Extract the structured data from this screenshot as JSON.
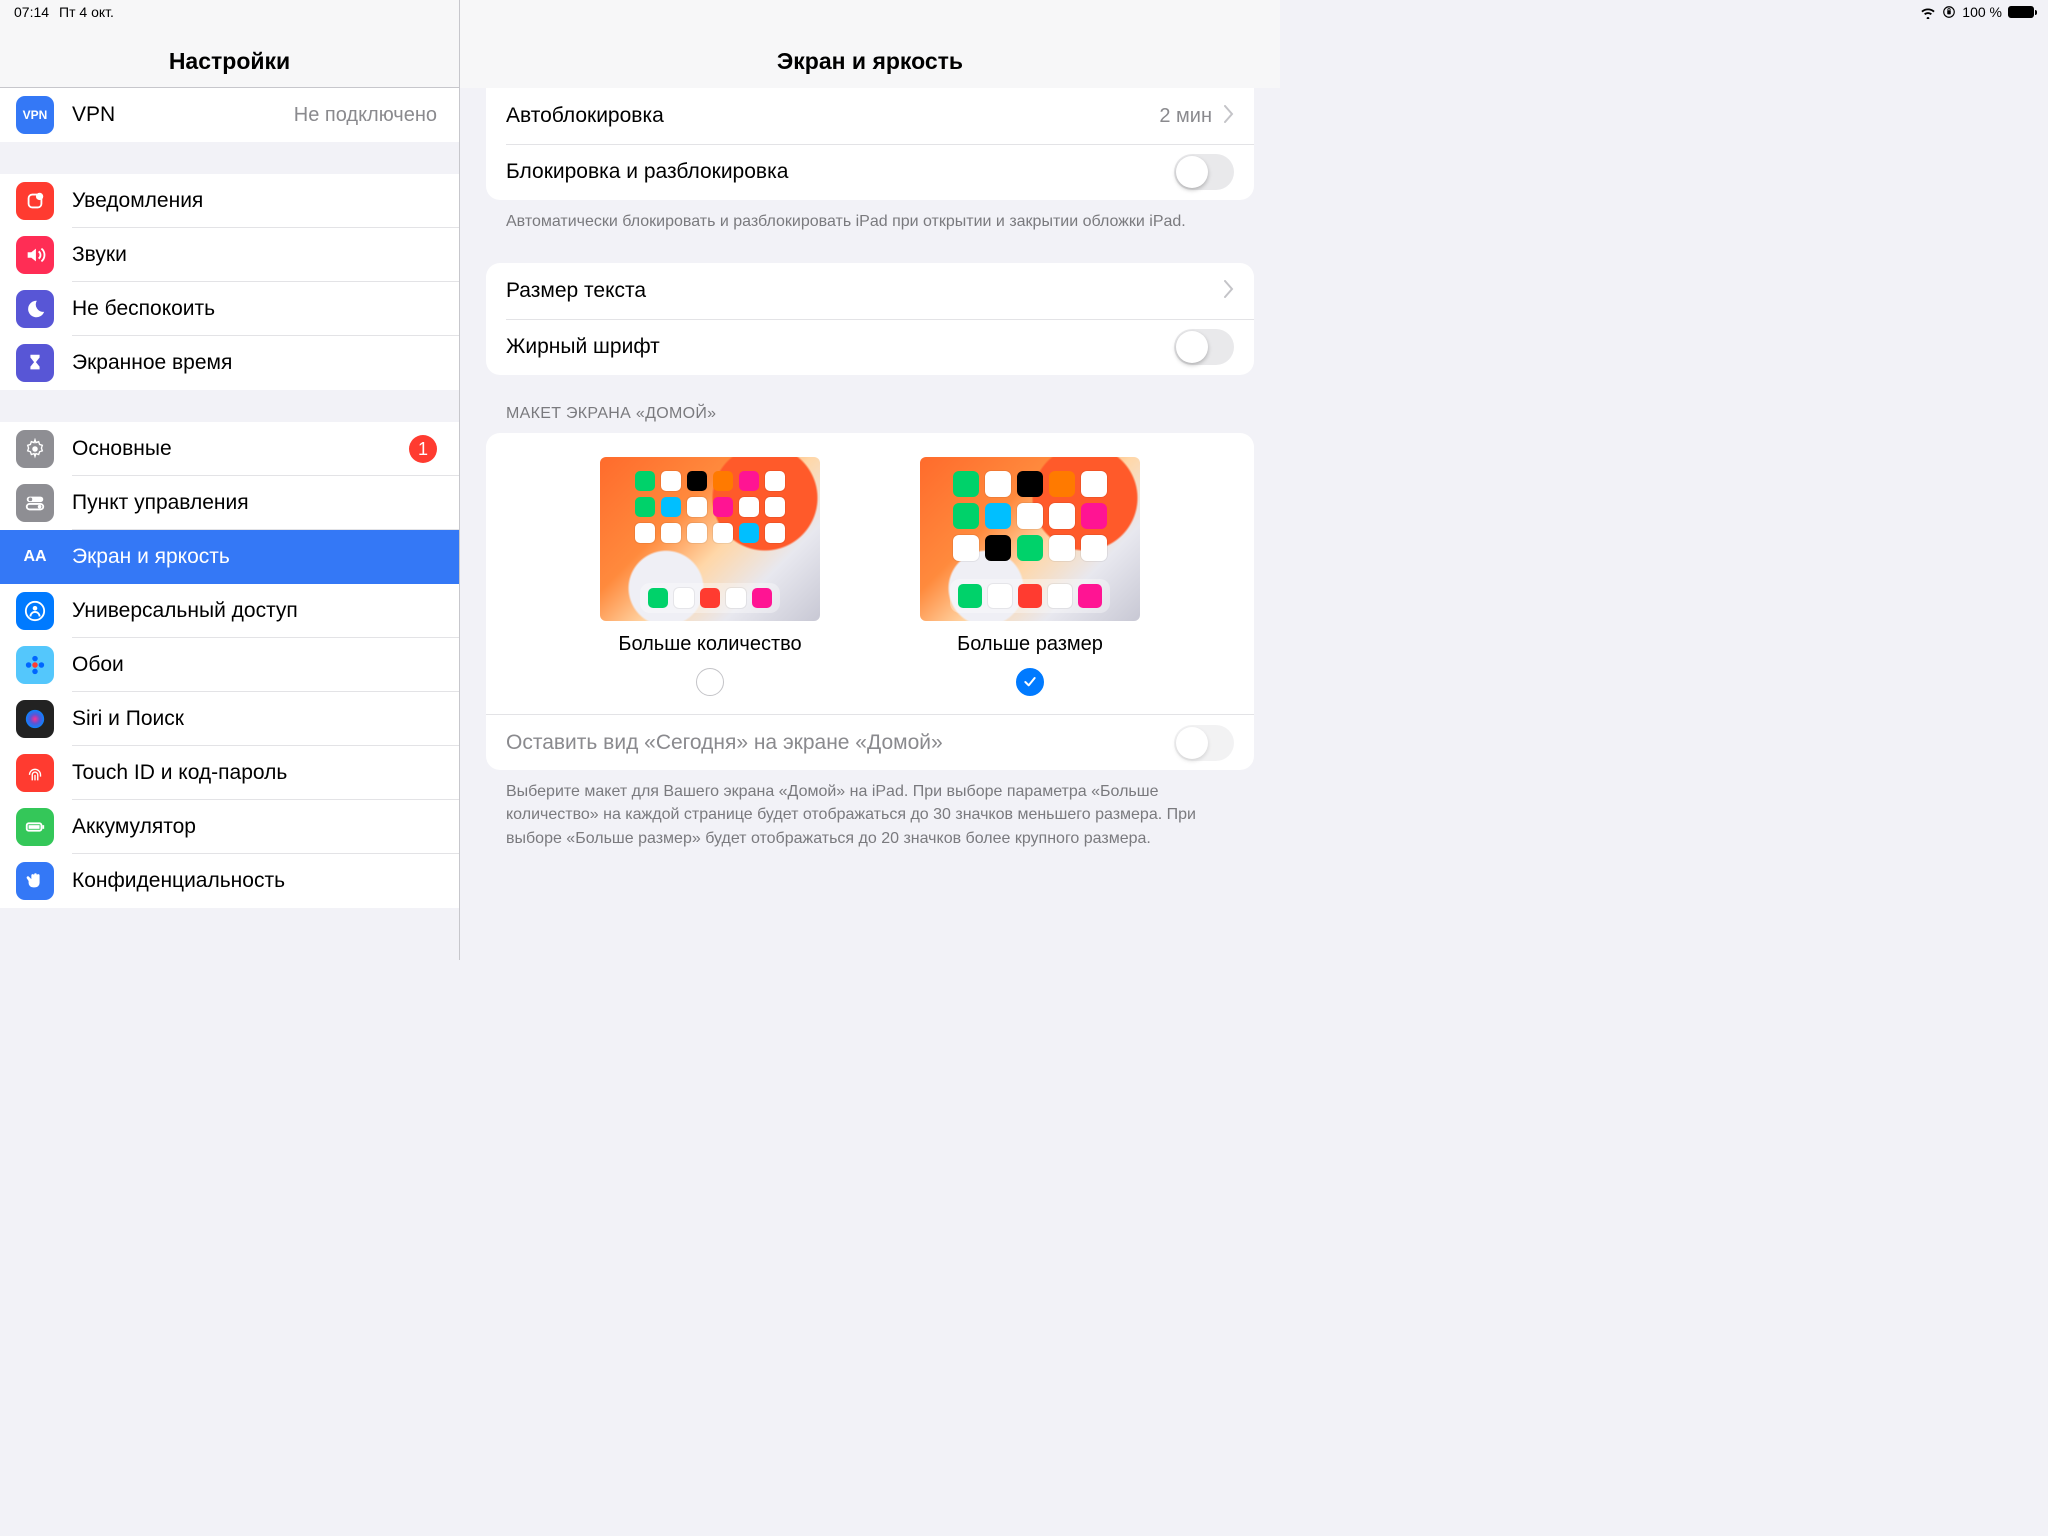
{
  "status": {
    "time": "07:14",
    "date": "Пт 4 окт.",
    "battery": "100 %"
  },
  "sidebar": {
    "title": "Настройки",
    "groups": [
      {
        "items": [
          {
            "id": "vpn",
            "label": "VPN",
            "status": "Не подключено",
            "icon": "vpn",
            "bg": "#3478f6"
          }
        ]
      },
      {
        "items": [
          {
            "id": "notifications",
            "label": "Уведомления",
            "icon": "bell",
            "bg": "#ff3b30"
          },
          {
            "id": "sounds",
            "label": "Звуки",
            "icon": "speaker",
            "bg": "#ff2d55"
          },
          {
            "id": "dnd",
            "label": "Не беспокоить",
            "icon": "moon",
            "bg": "#5856d6"
          },
          {
            "id": "screentime",
            "label": "Экранное время",
            "icon": "hourglass",
            "bg": "#5856d6"
          }
        ]
      },
      {
        "items": [
          {
            "id": "general",
            "label": "Основные",
            "icon": "gear",
            "bg": "#8e8e93",
            "badge": "1"
          },
          {
            "id": "control",
            "label": "Пункт управления",
            "icon": "toggles",
            "bg": "#8e8e93"
          },
          {
            "id": "display",
            "label": "Экран и яркость",
            "icon": "aa",
            "bg": "#3478f6",
            "selected": true
          },
          {
            "id": "accessibility",
            "label": "Универсальный доступ",
            "icon": "person",
            "bg": "#007aff"
          },
          {
            "id": "wallpaper",
            "label": "Обои",
            "icon": "flower",
            "bg": "#54c7fc"
          },
          {
            "id": "siri",
            "label": "Siri и Поиск",
            "icon": "siri",
            "bg": "#222"
          },
          {
            "id": "touchid",
            "label": "Touch ID и код-пароль",
            "icon": "finger",
            "bg": "#ff3b30"
          },
          {
            "id": "battery",
            "label": "Аккумулятор",
            "icon": "battery",
            "bg": "#34c759"
          },
          {
            "id": "privacy",
            "label": "Конфиденциальность",
            "icon": "hand",
            "bg": "#3478f6"
          }
        ]
      }
    ]
  },
  "detail": {
    "title": "Экран и яркость",
    "g1": {
      "autolock": {
        "label": "Автоблокировка",
        "value": "2 мин"
      },
      "lockunlock": {
        "label": "Блокировка и разблокировка"
      },
      "note": "Автоматически блокировать и разблокировать iPad при открытии и закрытии обложки iPad."
    },
    "g2": {
      "textsize": {
        "label": "Размер текста"
      },
      "bold": {
        "label": "Жирный шрифт"
      }
    },
    "home": {
      "header": "МАКЕТ ЭКРАНА «ДОМОЙ»",
      "more": {
        "label": "Больше количество",
        "checked": false
      },
      "bigger": {
        "label": "Больше размер",
        "checked": true
      },
      "today": {
        "label": "Оставить вид «Сегодня» на экране «Домой»"
      },
      "note": "Выберите макет для Вашего экрана «Домой» на iPad. При выборе параметра «Больше количество» на каждой странице будет отображаться до 30 значков меньшего размера. При выборе «Больше размер» будет отображаться до 20 значков более крупного размера."
    }
  },
  "iconColors": {
    "more": [
      "#00d26a",
      "#fff",
      "#000",
      "#ff7a00",
      "#ff1493",
      "#fff",
      "#00d26a",
      "#00bfff",
      "#fff",
      "#ff1493",
      "#fff",
      "#fff",
      "#fff",
      "#fff",
      "#fff",
      "#fff",
      "#00bfff",
      "#fff"
    ],
    "less": [
      "#00d26a",
      "#fff",
      "#000",
      "#ff7a00",
      "#fff",
      "#00d26a",
      "#00bfff",
      "#fff",
      "#fff",
      "#ff1493",
      "#fff",
      "#000",
      "#00d26a",
      "#fff",
      "#fff"
    ],
    "dockMore": [
      "#00d26a",
      "#fff",
      "#ff3b30",
      "#fff",
      "#ff1493"
    ],
    "dockLess": [
      "#00d26a",
      "#fff",
      "#ff3b30",
      "#fff",
      "#ff1493"
    ]
  }
}
